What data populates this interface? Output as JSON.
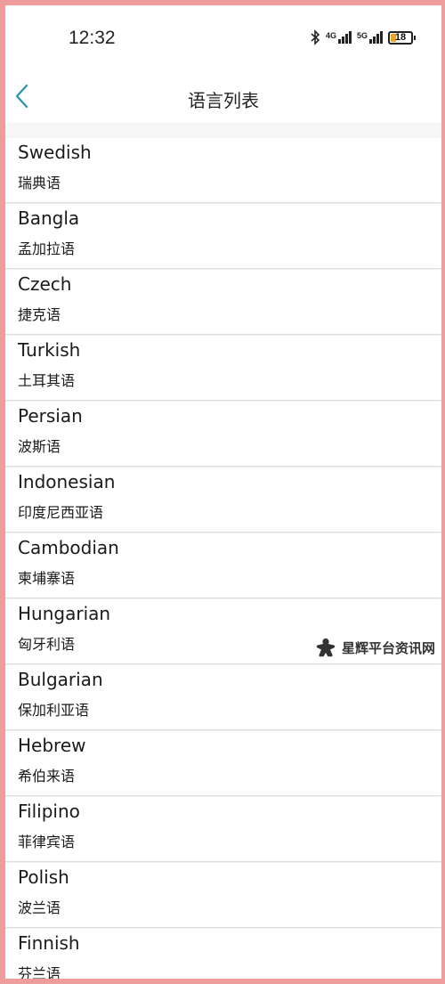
{
  "status_bar": {
    "time": "12:32",
    "network_1": "4G",
    "network_2": "5G",
    "battery": "18"
  },
  "header": {
    "title": "语言列表"
  },
  "languages": [
    {
      "name": "Swedish",
      "native": "瑞典语"
    },
    {
      "name": "Bangla",
      "native": "孟加拉语"
    },
    {
      "name": "Czech",
      "native": "捷克语"
    },
    {
      "name": "Turkish",
      "native": "土耳其语"
    },
    {
      "name": "Persian",
      "native": "波斯语"
    },
    {
      "name": "Indonesian",
      "native": "印度尼西亚语"
    },
    {
      "name": "Cambodian",
      "native": "柬埔寨语"
    },
    {
      "name": "Hungarian",
      "native": "匈牙利语"
    },
    {
      "name": "Bulgarian",
      "native": "保加利亚语"
    },
    {
      "name": "Hebrew",
      "native": "希伯来语"
    },
    {
      "name": "Filipino",
      "native": "菲律宾语"
    },
    {
      "name": "Polish",
      "native": "波兰语"
    },
    {
      "name": "Finnish",
      "native": "芬兰语"
    }
  ],
  "watermark": {
    "text": "星辉平台资讯网"
  },
  "colors": {
    "accent": "#2a8fb0",
    "border_frame": "#ee9c9c",
    "battery_fill": "#f3a21c"
  }
}
